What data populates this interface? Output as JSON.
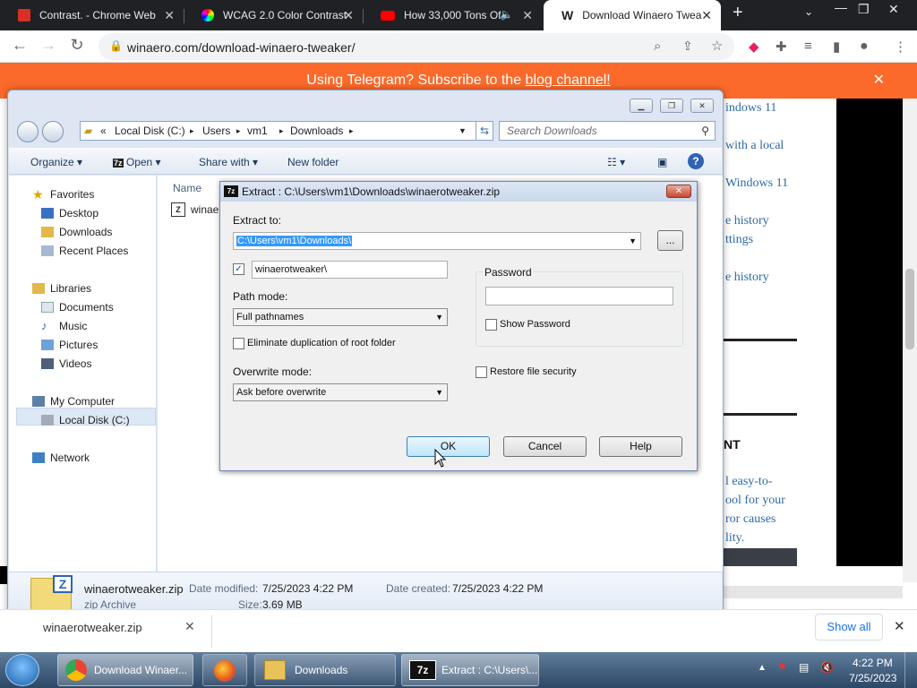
{
  "browser": {
    "tabs": [
      {
        "label": "Contrast. - Chrome Web",
        "icon": "contrast-icon"
      },
      {
        "label": "WCAG 2.0 Color Contrast",
        "icon": "color-wheel-icon"
      },
      {
        "label": "How 33,000 Tons Of",
        "icon": "youtube-icon"
      },
      {
        "label": "Download Winaero Twea",
        "icon": "winaero-icon"
      }
    ],
    "url": "winaero.com/download-winaero-tweaker/"
  },
  "page": {
    "banner_text": "Using Telegram? Subscribe to the ",
    "banner_link": "blog channel!",
    "sidebar_links": [
      "indows 11",
      "with a local",
      "Windows 11",
      "e history",
      "ttings",
      "e history"
    ],
    "heading_partial": "NT",
    "body_lines": [
      "l easy-to-",
      "ool for your",
      "ror causes",
      "lity."
    ]
  },
  "explorer": {
    "breadcrumb": [
      "«",
      "Local Disk (C:)",
      "Users",
      "vm1",
      "Downloads"
    ],
    "search_placeholder": "Search Downloads",
    "commands": {
      "organize": "Organize",
      "open": "Open",
      "share": "Share with",
      "newfolder": "New folder"
    },
    "nav": {
      "favorites": "Favorites",
      "desktop": "Desktop",
      "downloads": "Downloads",
      "recent": "Recent Places",
      "libraries": "Libraries",
      "documents": "Documents",
      "music": "Music",
      "pictures": "Pictures",
      "videos": "Videos",
      "computer": "My Computer",
      "localdisk": "Local Disk (C:)",
      "network": "Network"
    },
    "column_name": "Name",
    "file_partial": "winae",
    "details": {
      "filename": "winaerotweaker.zip",
      "type": "zip Archive",
      "modified_label": "Date modified:",
      "modified_value": "7/25/2023 4:22 PM",
      "created_label": "Date created:",
      "created_value": "7/25/2023 4:22 PM",
      "size_label": "Size:",
      "size_value": "3.69 MB"
    }
  },
  "dialog": {
    "title": "Extract : C:\\Users\\vm1\\Downloads\\winaerotweaker.zip",
    "extract_to_label": "Extract to:",
    "extract_to_value": "C:\\Users\\vm1\\Downloads\\",
    "browse_label": "...",
    "subfolder_value": "winaerotweaker\\",
    "path_mode_label": "Path mode:",
    "path_mode_value": "Full pathnames",
    "eliminate_label": "Eliminate duplication of root folder",
    "overwrite_label": "Overwrite mode:",
    "overwrite_value": "Ask before overwrite",
    "password_label": "Password",
    "show_password_label": "Show Password",
    "restore_security_label": "Restore file security",
    "ok": "OK",
    "cancel": "Cancel",
    "help": "Help"
  },
  "downloads_bar": {
    "item": "winaerotweaker.zip",
    "show_all": "Show all"
  },
  "taskbar": {
    "items": [
      "Download Winaer...",
      "Downloads",
      "Extract : C:\\Users\\..."
    ],
    "time": "4:22 PM",
    "date": "7/25/2023"
  }
}
